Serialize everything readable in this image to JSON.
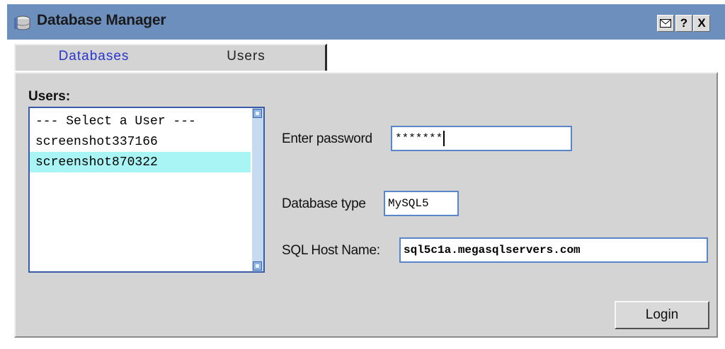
{
  "window": {
    "title": "Database Manager",
    "icon": "database-manager-icon",
    "help_label": "?",
    "close_label": "X"
  },
  "tabs": [
    {
      "label": "Databases",
      "active": true
    },
    {
      "label": "Users",
      "active": false
    }
  ],
  "users": {
    "label": "Users:",
    "items": [
      {
        "label": "--- Select a User ---",
        "selected": false
      },
      {
        "label": "screenshot337166",
        "selected": false
      },
      {
        "label": "screenshot870322",
        "selected": true
      }
    ]
  },
  "form": {
    "password_label": "Enter password",
    "password_value": "*******",
    "db_type_label": "Database type",
    "db_type_value": "MySQL5",
    "host_label": "SQL Host Name:",
    "host_value": "sql5c1a.megasqlservers.com"
  },
  "actions": {
    "login_label": "Login"
  },
  "colors": {
    "titlebar": "#6d8fbe",
    "panel": "#d4d4d4",
    "active_tab_text": "#2a36c9",
    "selected_row": "#a9f5f5"
  }
}
